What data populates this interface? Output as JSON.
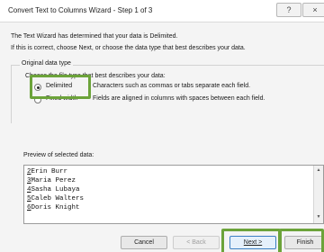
{
  "window": {
    "title": "Convert Text to Columns Wizard - Step 1 of 3",
    "help_icon": "?",
    "close_icon": "×"
  },
  "intro": {
    "line1": "The Text Wizard has determined that your data is Delimited.",
    "line2": "If this is correct, choose Next, or choose the data type that best describes your data."
  },
  "original_data_type": {
    "group_label": "Original data type",
    "choose_label": "Choose the file type that best describes your data:",
    "options": [
      {
        "label": "Delimited",
        "description": "Characters such as commas or tabs separate each field.",
        "selected": true
      },
      {
        "label": "Fixed width",
        "description": "Fields are aligned in columns with spaces between each field.",
        "selected": false
      }
    ]
  },
  "preview": {
    "label": "Preview of selected data:",
    "rows": [
      {
        "num": "2",
        "text": "Erin Burr"
      },
      {
        "num": "3",
        "text": "Maria Perez"
      },
      {
        "num": "4",
        "text": "Sasha Lubaya"
      },
      {
        "num": "5",
        "text": "Caleb Walters"
      },
      {
        "num": "6",
        "text": "Doris Knight"
      }
    ]
  },
  "buttons": {
    "cancel": "Cancel",
    "back": "< Back",
    "next": "Next >",
    "finish": "Finish"
  },
  "colors": {
    "highlight": "#6ca33a",
    "default_button_border": "#3c7fc3"
  }
}
